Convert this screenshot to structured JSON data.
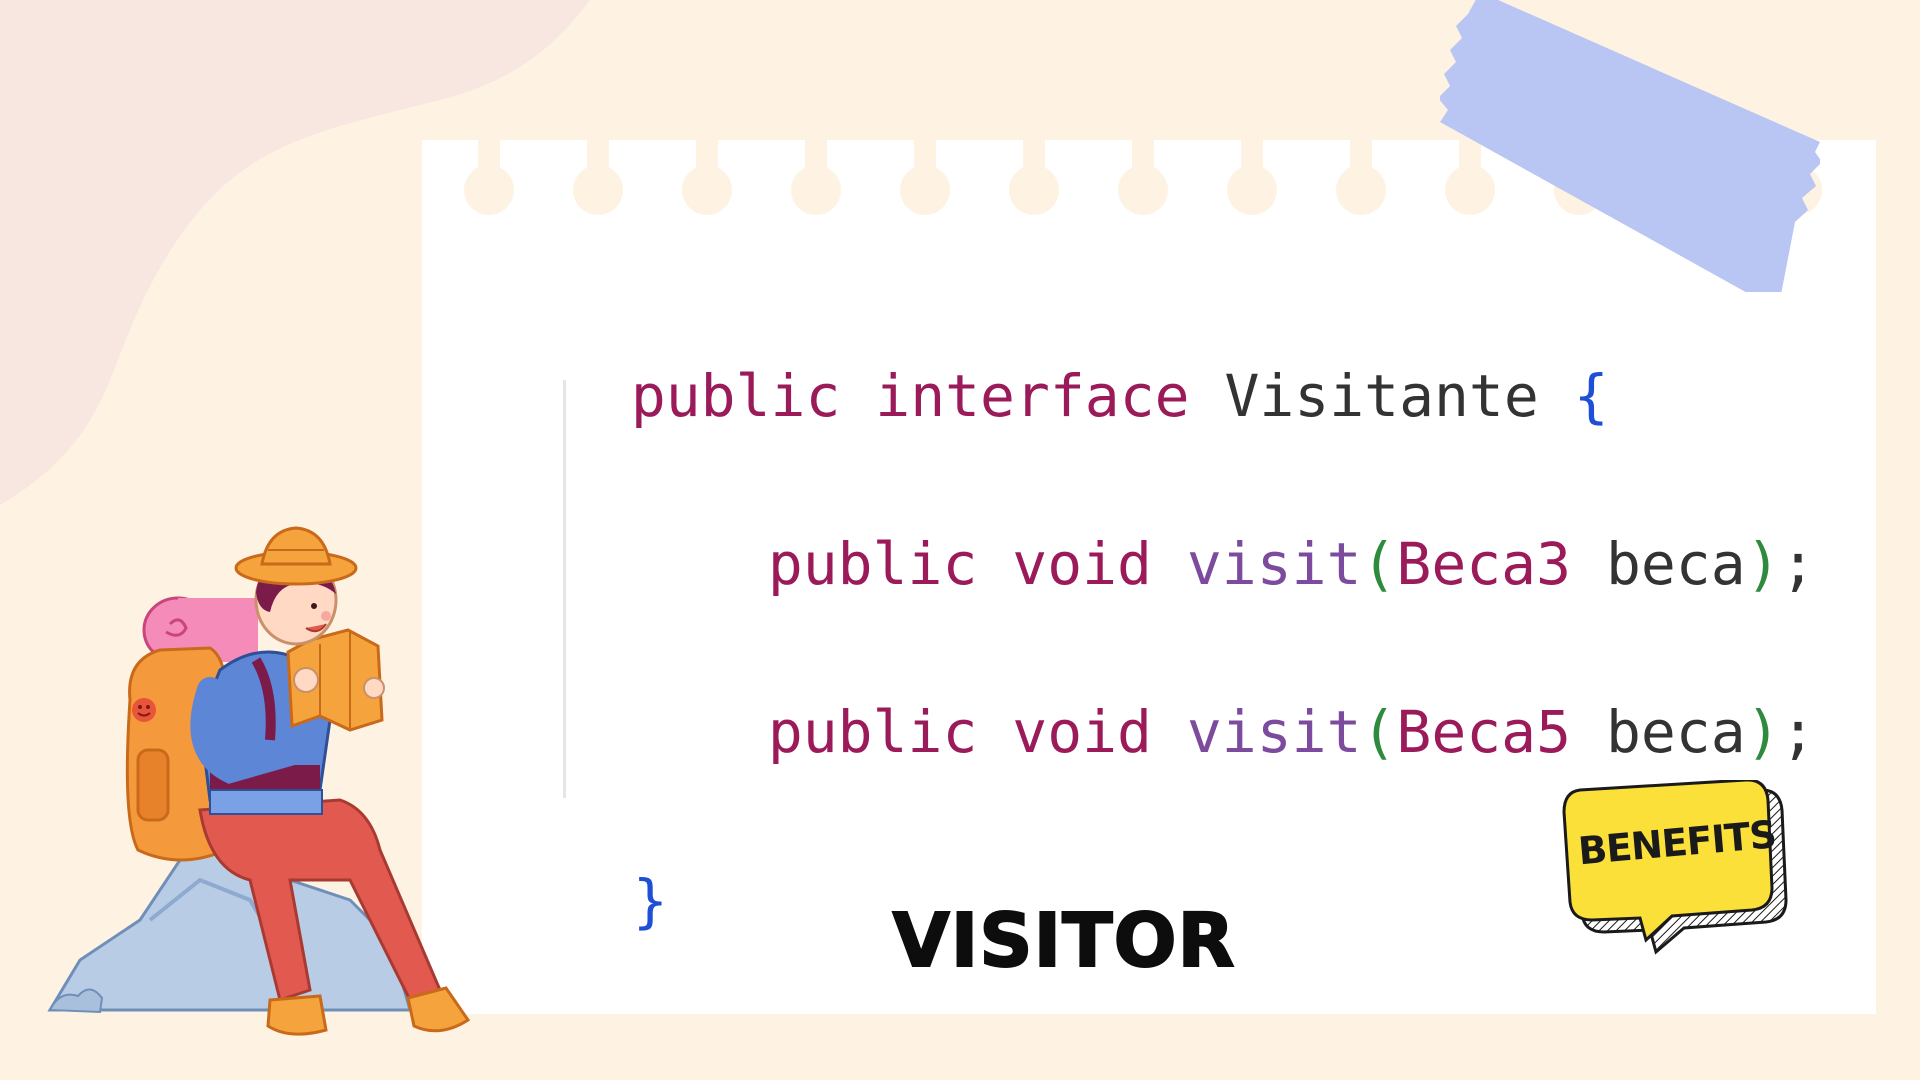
{
  "code": {
    "line1": {
      "kw1": "public",
      "kw2": "interface",
      "name": "Visitante",
      "open": "{"
    },
    "line2": {
      "kw1": "public",
      "kw2": "void",
      "fn": "visit",
      "lp": "(",
      "type": "Beca3",
      "param": "beca",
      "rp": ")",
      "semi": ";"
    },
    "line3": {
      "kw1": "public",
      "kw2": "void",
      "fn": "visit",
      "lp": "(",
      "type": "Beca5",
      "param": "beca",
      "rp": ")",
      "semi": ";"
    },
    "close": "}"
  },
  "title": "VISITOR",
  "badge": {
    "label": "BENEFITS"
  },
  "colors": {
    "background": "#fef3e3",
    "blob": "#f8e6e1",
    "paper": "#ffffff",
    "tape": "#b9c5f2",
    "keyword": "#9b1b5a",
    "function": "#7c4b9e",
    "paren": "#2e8b3e",
    "brace": "#1f4fd6",
    "badge": "#fbe03a"
  },
  "icons": [
    "hiker-illustration",
    "tape-decoration",
    "speech-badge"
  ]
}
